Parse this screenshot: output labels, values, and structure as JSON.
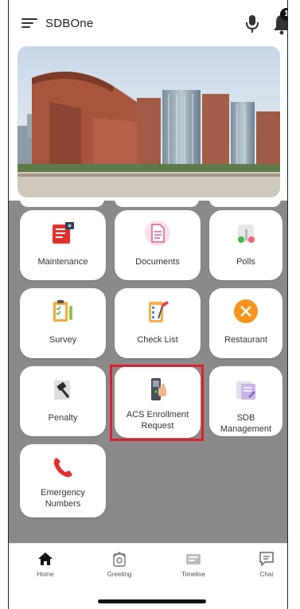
{
  "app": {
    "title": "SDBOne",
    "notification_count": "1"
  },
  "tiles": [
    {
      "label": "Maintenance",
      "icon": "maintenance-icon"
    },
    {
      "label": "Documents",
      "icon": "documents-icon"
    },
    {
      "label": "Polls",
      "icon": "polls-icon"
    },
    {
      "label": "Survey",
      "icon": "survey-icon"
    },
    {
      "label": "Check List",
      "icon": "checklist-icon"
    },
    {
      "label": "Restaurant",
      "icon": "restaurant-icon"
    },
    {
      "label": "Penalty",
      "icon": "penalty-icon"
    },
    {
      "label": "ACS Enrollment Request",
      "icon": "acs-enrollment-icon"
    },
    {
      "label": "SDB Management",
      "icon": "sdb-management-icon"
    },
    {
      "label": "Emergency Numbers",
      "icon": "emergency-phone-icon"
    }
  ],
  "bottom_nav": [
    {
      "label": "Home",
      "icon": "home-icon"
    },
    {
      "label": "Greeting",
      "icon": "greeting-icon"
    },
    {
      "label": "Timeline",
      "icon": "timeline-icon"
    },
    {
      "label": "Chat",
      "icon": "chat-icon"
    }
  ],
  "colors": {
    "grid_background": "#8a8a8a",
    "highlight": "#e01e2e",
    "tile": "#ffffff"
  }
}
